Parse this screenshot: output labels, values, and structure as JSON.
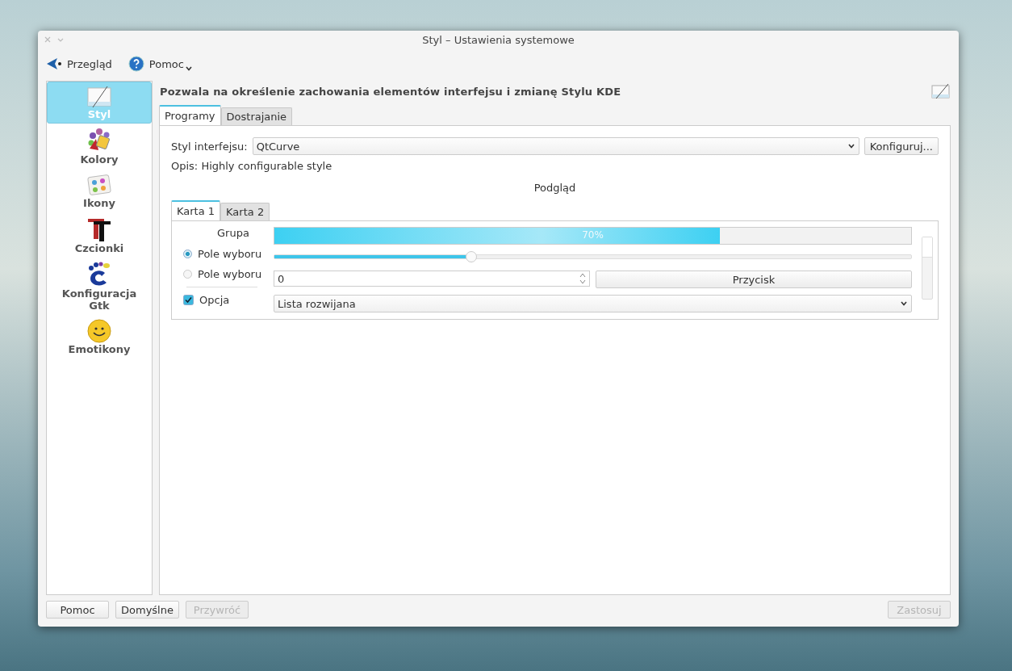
{
  "window": {
    "title": "Styl – Ustawienia systemowe"
  },
  "toolbar": [
    {
      "kind": "back",
      "label": "Przegląd"
    },
    {
      "kind": "help",
      "label": "Pomoc"
    }
  ],
  "sidebar": {
    "items": [
      {
        "kind": "style",
        "label": "Styl",
        "selected": true
      },
      {
        "kind": "colors",
        "label": "Kolory",
        "selected": false
      },
      {
        "kind": "icons",
        "label": "Ikony",
        "selected": false
      },
      {
        "kind": "fonts",
        "label": "Czcionki",
        "selected": false
      },
      {
        "kind": "gtk",
        "label": "Konfiguracja Gtk",
        "selected": false
      },
      {
        "kind": "emoticons",
        "label": "Emotikony",
        "selected": false
      }
    ]
  },
  "header": "Pozwala na określenie zachowania elementów interfejsu i zmianę Stylu KDE",
  "tabs": [
    {
      "label": "Programy",
      "selected": true
    },
    {
      "label": "Dostrajanie",
      "selected": false
    }
  ],
  "style_field": {
    "label": "Styl interfejsu:",
    "value": "QtCurve",
    "button": "Konfiguruj..."
  },
  "description": "Opis: Highly configurable style",
  "preview": {
    "title": "Podgląd",
    "tabs": [
      {
        "label": "Karta 1",
        "selected": true
      },
      {
        "label": "Karta 2",
        "selected": false
      }
    ],
    "group": "Grupa",
    "radios": [
      {
        "label": "Pole wyboru",
        "selected": true
      },
      {
        "label": "Pole wyboru",
        "selected": false
      }
    ],
    "checkbox": {
      "label": "Opcja",
      "checked": true
    },
    "progress": {
      "level": 0.7,
      "reading": "70%"
    },
    "slider": {
      "level": 0.31
    },
    "spin": {
      "value": "0"
    },
    "button": "Przycisk",
    "combo": "Lista rozwijana"
  },
  "buttons": [
    {
      "label": "Pomoc",
      "disabled": false
    },
    {
      "label": "Domyślne",
      "disabled": false
    },
    {
      "label": "Przywróć",
      "disabled": true
    },
    {
      "label": "Zastosuj",
      "disabled": true
    }
  ]
}
